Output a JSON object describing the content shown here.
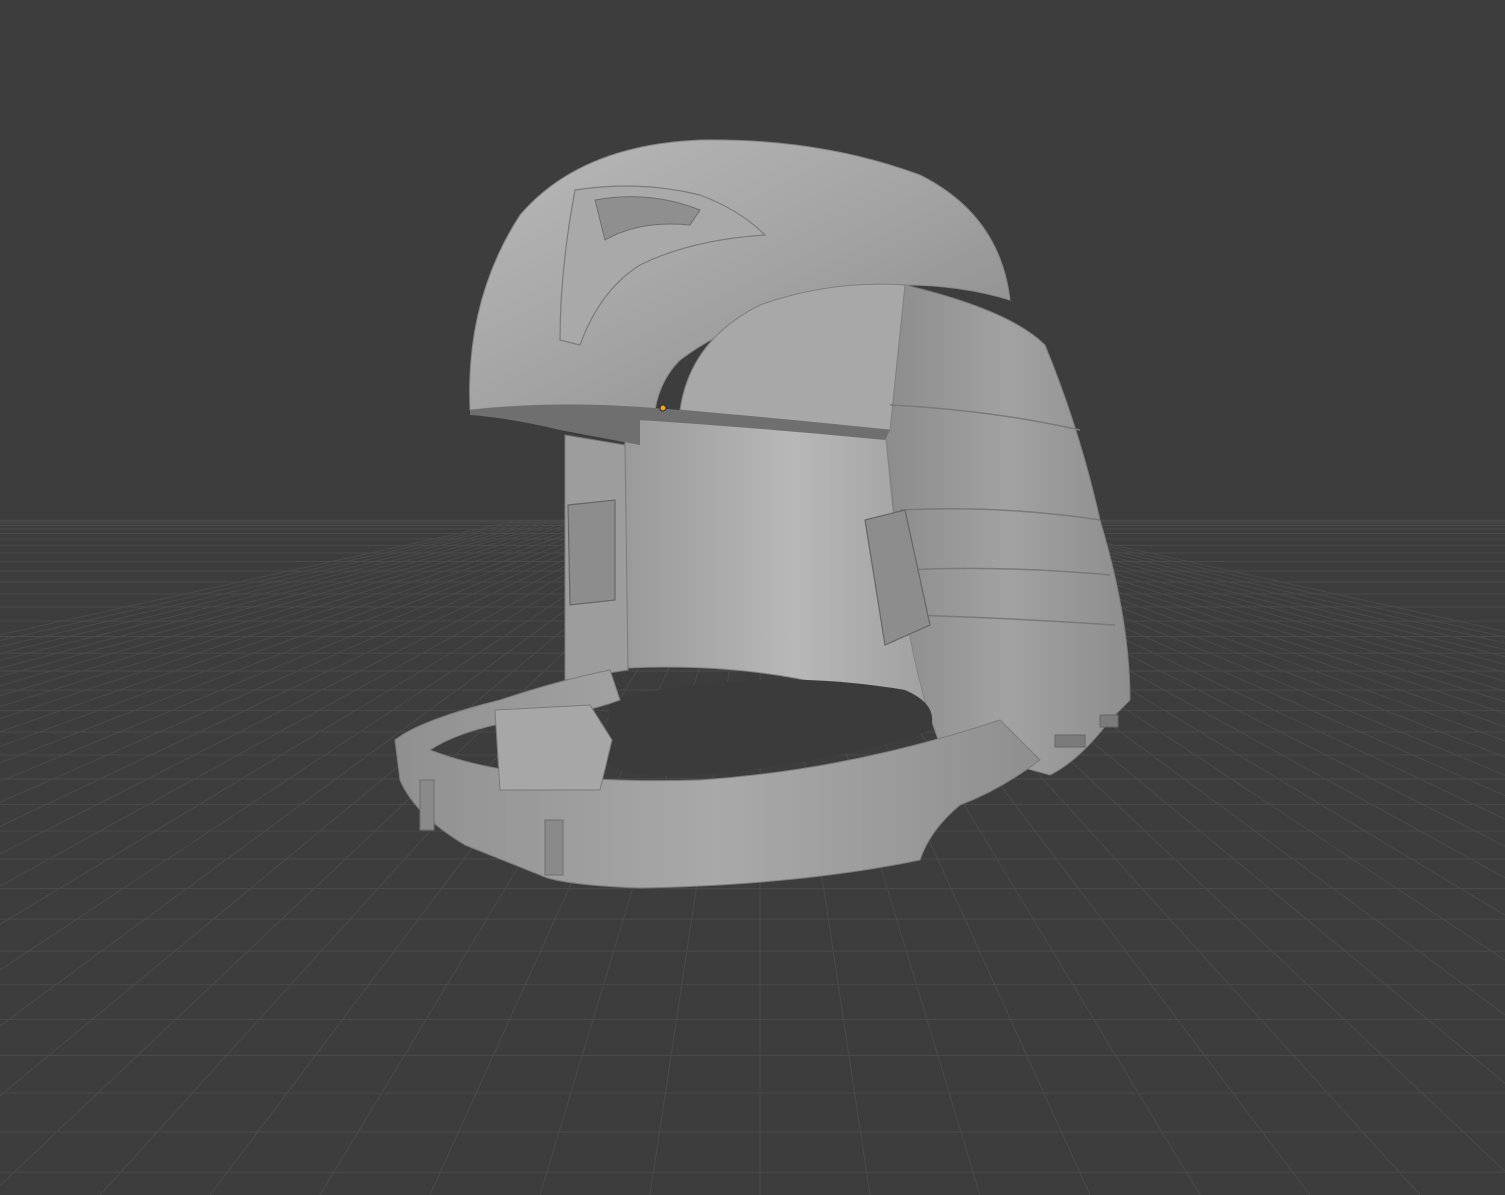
{
  "viewport": {
    "background_color": "#3d3d3d",
    "grid_line_color": "#4a4a4a",
    "object_color": "#9c9c9c",
    "object_shadow_color": "#6e6e6e",
    "object_highlight_color": "#c4c4c4",
    "origin_color": "#f5a623",
    "object_icon": "helmet-mesh-icon",
    "origin_icon": "object-origin-icon"
  }
}
